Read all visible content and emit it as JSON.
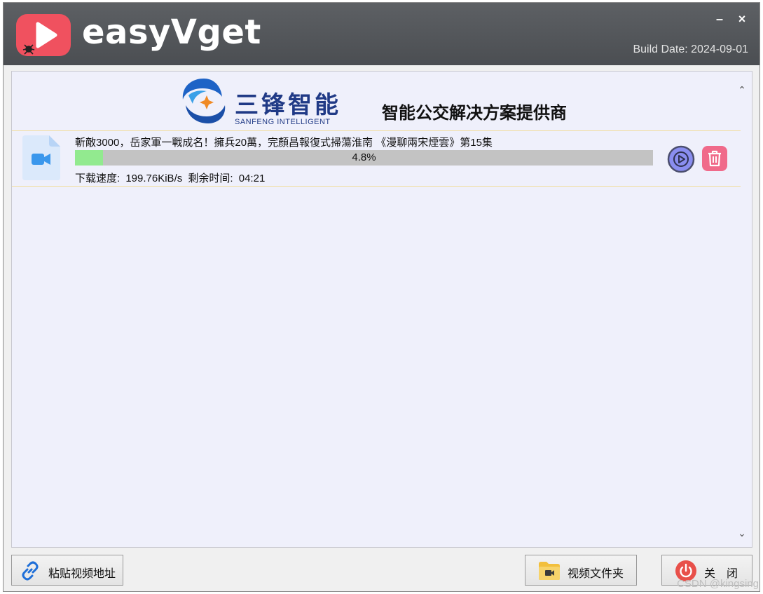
{
  "app": {
    "title": "easyVget",
    "build_date": "Build Date: 2024-09-01",
    "minimize_label": "–",
    "close_label": "×"
  },
  "banner": {
    "brand_cn": "三锋智能",
    "brand_en": "SANFENG INTELLIGENT",
    "slogan": "智能公交解决方案提供商"
  },
  "download": {
    "title": "斬敵3000，岳家軍一戰成名！擁兵20萬，完顏昌報復式掃蕩淮南 《漫聊兩宋煙雲》第15集",
    "progress_fraction": 0.048,
    "progress_text": "4.8%",
    "speed_label": "下载速度:",
    "speed_value": "199.76KiB/s",
    "remaining_label": "剩余时间:",
    "remaining_value": "04:21"
  },
  "buttons": {
    "paste": "粘贴视频地址",
    "folder": "视频文件夹",
    "close": "关　闭"
  },
  "watermark": "CSDN @kingsing",
  "colors": {
    "title_bar": "#4f5256",
    "logo_red": "#f0515f",
    "content_bg": "#eff0fb",
    "progress_fill": "#92ea8f",
    "progress_track": "#c3c3c3",
    "play_accent": "#8a8ef0",
    "delete_accent": "#f06a8a"
  },
  "icons": {
    "app_logo": "play-logo-icon",
    "file": "video-file-icon",
    "play": "play-circle-icon",
    "delete": "trash-icon",
    "paste": "link-icon",
    "folder": "video-folder-icon",
    "close": "power-icon"
  }
}
